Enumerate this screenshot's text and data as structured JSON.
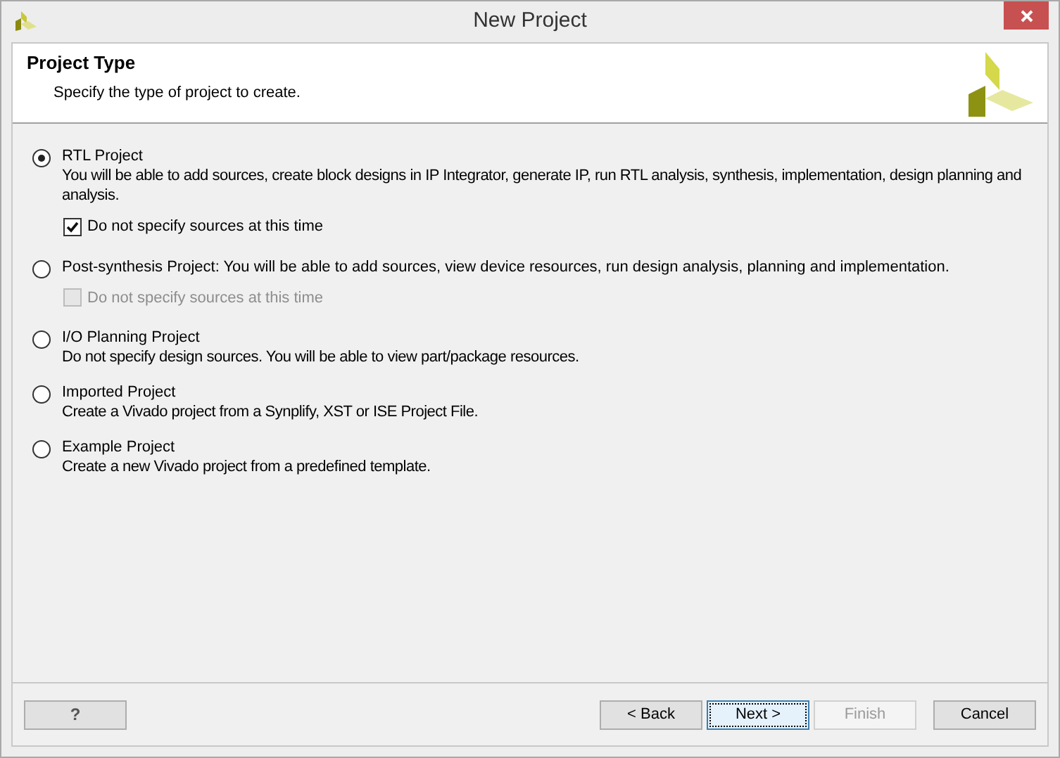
{
  "window": {
    "title": "New Project"
  },
  "header": {
    "title": "Project Type",
    "subtitle": "Specify the type of project to create."
  },
  "options": [
    {
      "label": "RTL Project",
      "description": "You will be able to add sources, create block designs in IP Integrator, generate IP, run RTL analysis, synthesis, implementation, design planning and analysis.",
      "selected": true,
      "checkbox": {
        "label": "Do not specify sources at this time",
        "checked": true,
        "disabled": false
      }
    },
    {
      "label": "Post-synthesis Project: You will be able to add sources, view device resources, run design analysis, planning and implementation.",
      "selected": false,
      "checkbox": {
        "label": "Do not specify sources at this time",
        "checked": false,
        "disabled": true
      }
    },
    {
      "label": "I/O Planning Project",
      "description": "Do not specify design sources. You will be able to view part/package resources.",
      "selected": false
    },
    {
      "label": "Imported Project",
      "description": "Create a Vivado project from a Synplify, XST or ISE Project File.",
      "selected": false
    },
    {
      "label": "Example Project",
      "description": "Create a new Vivado project from a predefined template.",
      "selected": false
    }
  ],
  "buttons": {
    "help": "?",
    "actions": [
      {
        "label": "< Back",
        "disabled": false,
        "focused": false
      },
      {
        "label": "Next >",
        "disabled": false,
        "focused": true
      },
      {
        "label": "Finish",
        "disabled": true,
        "focused": false
      },
      {
        "label": "Cancel",
        "disabled": false,
        "focused": false
      }
    ]
  }
}
